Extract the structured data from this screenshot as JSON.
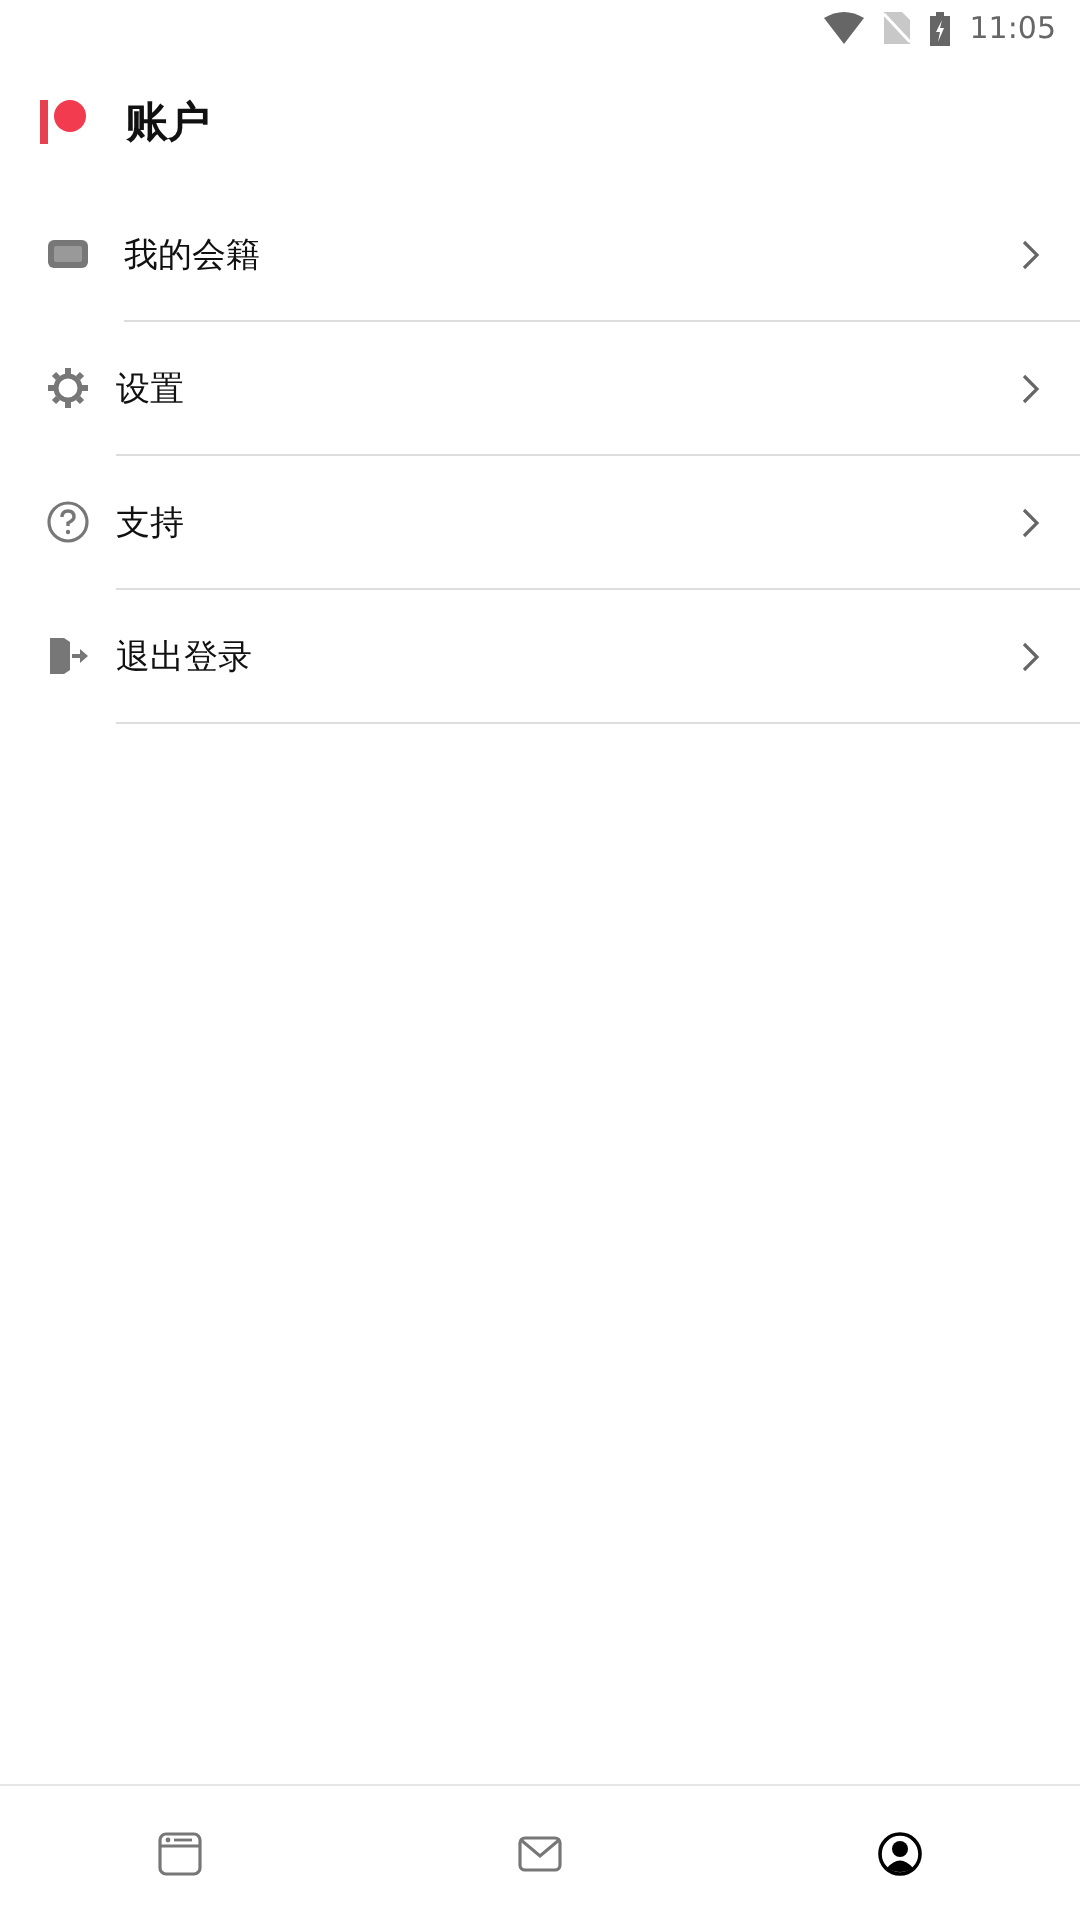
{
  "status_bar": {
    "time": "11:05"
  },
  "header": {
    "title": "账户"
  },
  "menu": [
    {
      "label": "我的会籍"
    },
    {
      "label": "设置"
    },
    {
      "label": "支持"
    },
    {
      "label": "退出登录"
    }
  ],
  "bottom_nav": [
    {
      "selected": false
    },
    {
      "selected": false
    },
    {
      "selected": true
    }
  ]
}
